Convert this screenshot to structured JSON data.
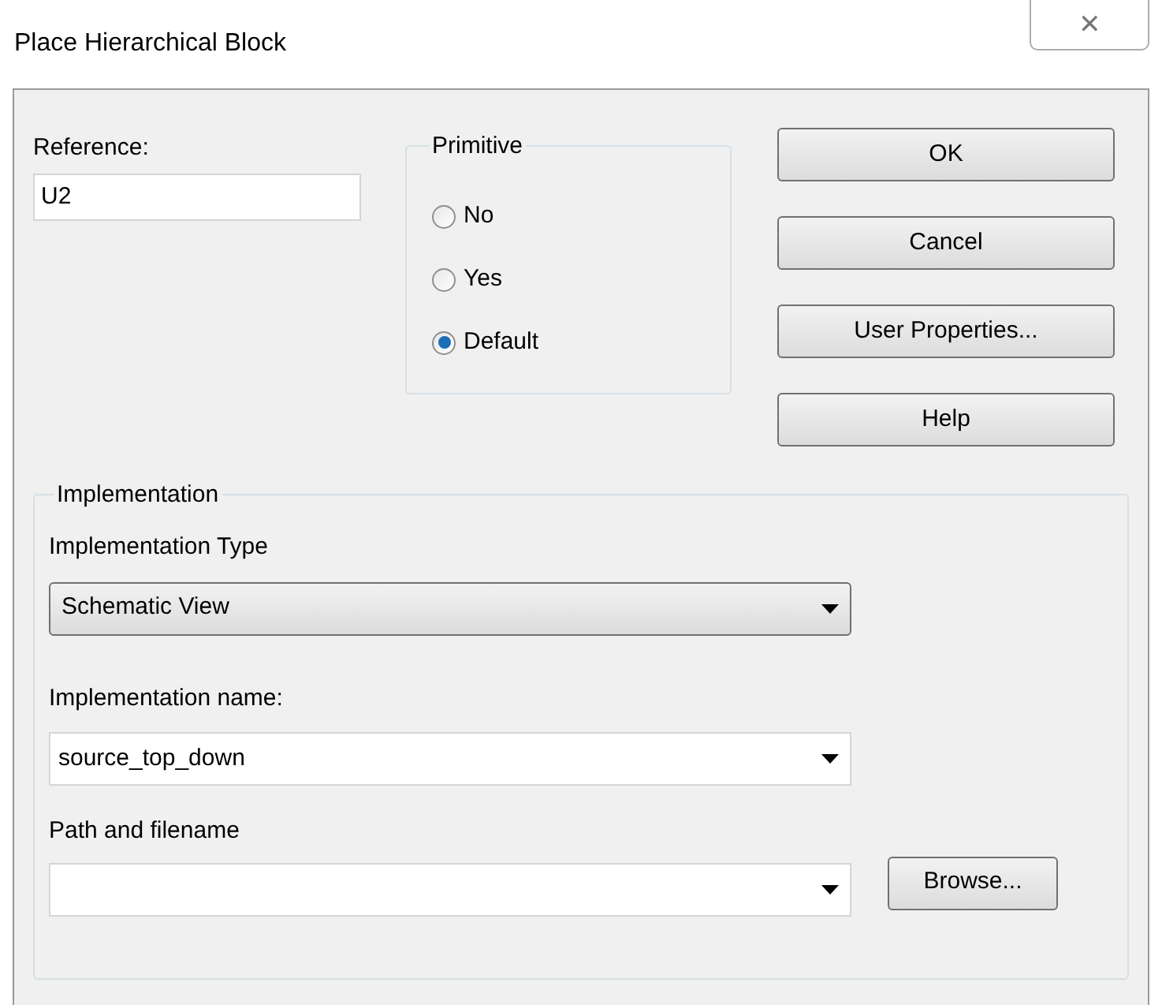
{
  "window": {
    "title": "Place Hierarchical Block",
    "close": "✕"
  },
  "reference": {
    "label": "Reference:",
    "value": "U2"
  },
  "primitive": {
    "title": "Primitive",
    "options": [
      {
        "label": "No",
        "selected": false
      },
      {
        "label": "Yes",
        "selected": false
      },
      {
        "label": "Default",
        "selected": true
      }
    ]
  },
  "buttons": [
    "OK",
    "Cancel",
    "User Properties...",
    "Help"
  ],
  "implementation": {
    "title": "Implementation",
    "type": {
      "label": "Implementation Type",
      "value": "Schematic View"
    },
    "name": {
      "label": "Implementation name:",
      "value": "source_top_down"
    },
    "path": {
      "label": "Path and filename",
      "button": "Browse..."
    }
  }
}
